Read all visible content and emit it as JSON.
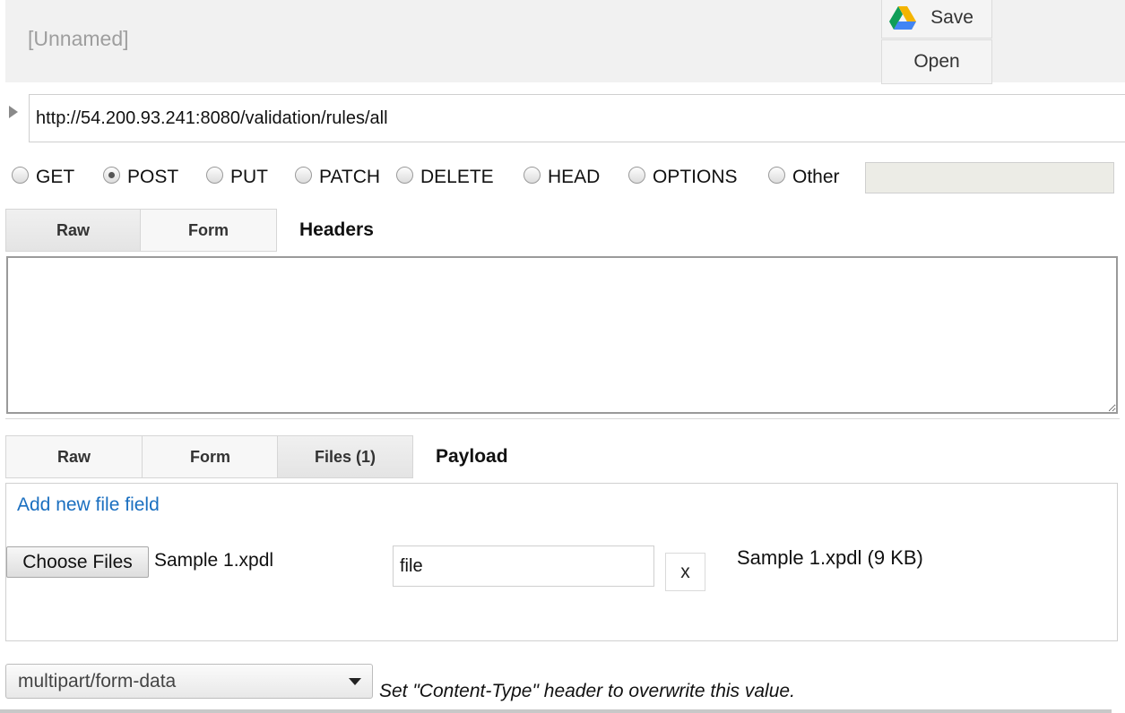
{
  "request": {
    "name": "[Unnamed]"
  },
  "toolbar": {
    "save_label": "Save",
    "open_label": "Open"
  },
  "url": {
    "value": "http://54.200.93.241:8080/validation/rules/all"
  },
  "methods": [
    {
      "label": "GET",
      "checked": false
    },
    {
      "label": "POST",
      "checked": true
    },
    {
      "label": "PUT",
      "checked": false
    },
    {
      "label": "PATCH",
      "checked": false
    },
    {
      "label": "DELETE",
      "checked": false
    },
    {
      "label": "HEAD",
      "checked": false
    },
    {
      "label": "OPTIONS",
      "checked": false
    },
    {
      "label": "Other",
      "checked": false
    }
  ],
  "headers": {
    "tabs": [
      {
        "label": "Raw",
        "active": true
      },
      {
        "label": "Form",
        "active": false
      }
    ],
    "title": "Headers",
    "value": ""
  },
  "payload": {
    "tabs": [
      {
        "label": "Raw",
        "active": false
      },
      {
        "label": "Form",
        "active": false
      },
      {
        "label": "Files (1)",
        "active": true
      }
    ],
    "title": "Payload",
    "add_field_link": "Add new file field",
    "file_field": {
      "choose_label": "Choose Files",
      "chosen_file": "Sample 1.xpdl",
      "field_name": "file",
      "remove_label": "x",
      "file_info": "Sample 1.xpdl (9 KB)"
    }
  },
  "content_type": {
    "selected": "multipart/form-data",
    "hint": "Set \"Content-Type\" header to overwrite this value."
  },
  "colors": {
    "link": "#1a6fc0",
    "topbar_bg": "#f1f1f1"
  }
}
